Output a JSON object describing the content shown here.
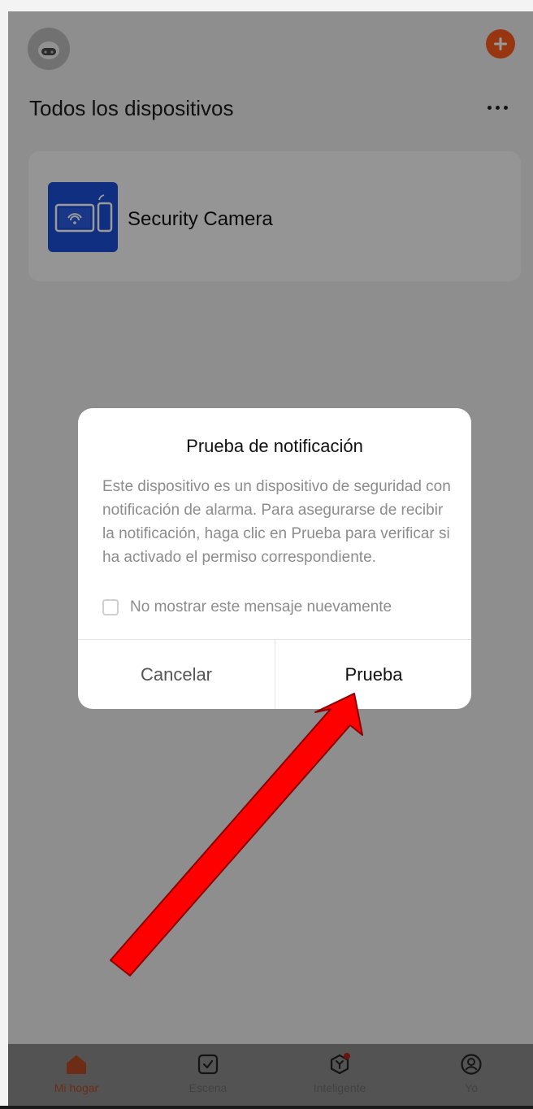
{
  "header": {
    "section_title": "Todos los dispositivos"
  },
  "devices": [
    {
      "name": "Security Camera",
      "icon": "tablet-phone-wifi-icon"
    }
  ],
  "dialog": {
    "title": "Prueba de notificación",
    "body": "Este dispositivo es un dispositivo de seguridad con notificación de alarma. Para asegurarse de recibir la notificación, haga clic en Prueba para verificar si ha activado el permiso correspondiente.",
    "checkbox_label": "No mostrar este mensaje nuevamente",
    "cancel_label": "Cancelar",
    "confirm_label": "Prueba"
  },
  "tabs": [
    {
      "label": "Mi hogar",
      "icon": "home-icon",
      "active": true
    },
    {
      "label": "Escena",
      "icon": "checkbox-icon",
      "active": false
    },
    {
      "label": "Inteligente",
      "icon": "smart-hex-icon",
      "active": false
    },
    {
      "label": "Yo",
      "icon": "user-icon",
      "active": false
    }
  ],
  "colors": {
    "accent": "#ff5a1f",
    "device_icon_bg": "#1b4fd6",
    "annotation_arrow": "#ff0000"
  }
}
